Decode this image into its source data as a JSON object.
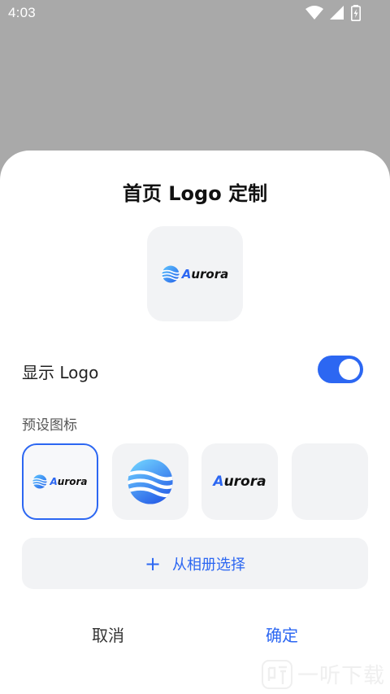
{
  "status_bar": {
    "time": "4:03",
    "icons": [
      "wifi-icon",
      "signal-icon",
      "battery-charging-icon"
    ]
  },
  "sheet": {
    "title": "首页 Logo 定制",
    "preview": {
      "wordmark": "Aurora"
    },
    "show_logo": {
      "label": "显示 Logo",
      "enabled": true
    },
    "presets": {
      "label": "预设图标",
      "items": [
        {
          "kind": "wordmark-with-mark",
          "text": "Aurora",
          "selected": true
        },
        {
          "kind": "mark-only",
          "selected": false
        },
        {
          "kind": "wordmark",
          "text": "Aurora",
          "selected": false
        },
        {
          "kind": "empty",
          "selected": false
        }
      ]
    },
    "album_button": {
      "label": "从相册选择"
    },
    "footer": {
      "cancel_label": "取消",
      "confirm_label": "确定"
    }
  },
  "watermark": {
    "text": "一听下载"
  },
  "colors": {
    "accent": "#2c67f2",
    "backdrop": "#a9a9a9",
    "tile_bg": "#f2f3f5"
  }
}
